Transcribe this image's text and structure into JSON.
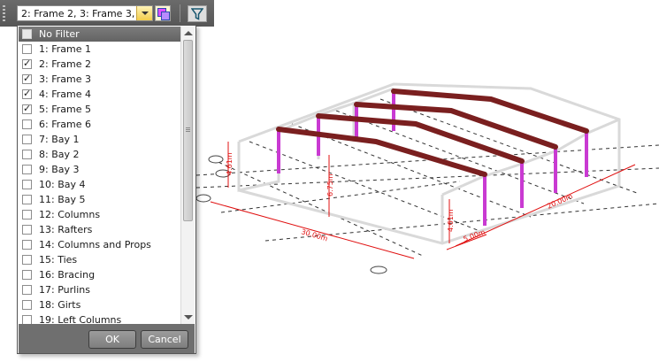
{
  "toolbar": {
    "filter_combo_value": "2: Frame 2, 3: Frame 3, ...",
    "multi_select_icon": "multi-select-icon",
    "filter_icon": "funnel-icon"
  },
  "popup": {
    "items": [
      {
        "label": "No Filter",
        "checked": false
      },
      {
        "label": "1: Frame 1",
        "checked": false
      },
      {
        "label": "2: Frame 2",
        "checked": true
      },
      {
        "label": "3: Frame 3",
        "checked": true
      },
      {
        "label": "4: Frame 4",
        "checked": true
      },
      {
        "label": "5: Frame 5",
        "checked": true
      },
      {
        "label": "6: Frame 6",
        "checked": false
      },
      {
        "label": "7: Bay 1",
        "checked": false
      },
      {
        "label": "8: Bay 2",
        "checked": false
      },
      {
        "label": "9: Bay 3",
        "checked": false
      },
      {
        "label": "10: Bay 4",
        "checked": false
      },
      {
        "label": "11: Bay 5",
        "checked": false
      },
      {
        "label": "12: Columns",
        "checked": false
      },
      {
        "label": "13: Rafters",
        "checked": false
      },
      {
        "label": "14: Columns and Props",
        "checked": false
      },
      {
        "label": "15: Ties",
        "checked": false
      },
      {
        "label": "16: Bracing",
        "checked": false
      },
      {
        "label": "17: Purlins",
        "checked": false
      },
      {
        "label": "18: Girts",
        "checked": false
      },
      {
        "label": "19: Left Columns",
        "checked": false
      }
    ],
    "ok_label": "OK",
    "cancel_label": "Cancel"
  },
  "model": {
    "dimensions": [
      "4.61m",
      "4.61m",
      "6.75m",
      "30.00m",
      "20.00m",
      "5.00m"
    ],
    "colors": {
      "rafter": "#7a1f1f",
      "column": "#c93ad2",
      "dimension": "#e01010",
      "frame": "#d9d9d9",
      "grid": "#333333"
    }
  }
}
